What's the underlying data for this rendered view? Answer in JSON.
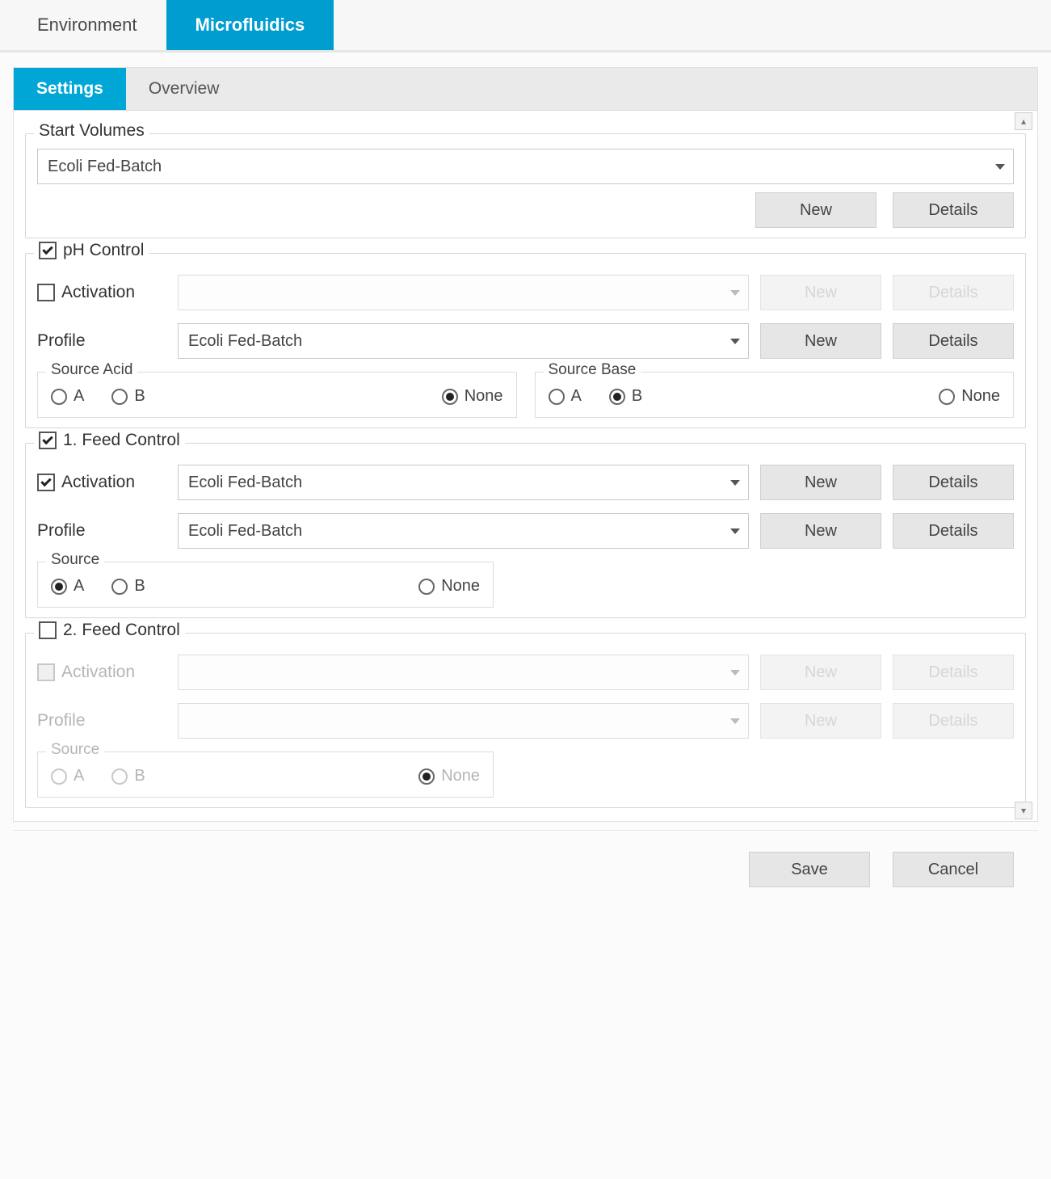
{
  "topTabs": {
    "environment": "Environment",
    "microfluidics": "Microfluidics",
    "active": "microfluidics"
  },
  "subTabs": {
    "settings": "Settings",
    "overview": "Overview",
    "active": "settings"
  },
  "startVolumes": {
    "legend": "Start Volumes",
    "selected": "Ecoli Fed-Batch",
    "newBtn": "New",
    "detailsBtn": "Details"
  },
  "phControl": {
    "legend": "pH Control",
    "checked": true,
    "activation": {
      "label": "Activation",
      "checked": false,
      "selected": "",
      "newBtn": "New",
      "detailsBtn": "Details"
    },
    "profile": {
      "label": "Profile",
      "selected": "Ecoli Fed-Batch",
      "newBtn": "New",
      "detailsBtn": "Details"
    },
    "sourceAcid": {
      "legend": "Source Acid",
      "options": {
        "a": "A",
        "b": "B",
        "none": "None"
      },
      "value": "none"
    },
    "sourceBase": {
      "legend": "Source Base",
      "options": {
        "a": "A",
        "b": "B",
        "none": "None"
      },
      "value": "b"
    }
  },
  "feed1": {
    "legend": "1. Feed Control",
    "checked": true,
    "activation": {
      "label": "Activation",
      "checked": true,
      "selected": "Ecoli Fed-Batch",
      "newBtn": "New",
      "detailsBtn": "Details"
    },
    "profile": {
      "label": "Profile",
      "selected": "Ecoli Fed-Batch",
      "newBtn": "New",
      "detailsBtn": "Details"
    },
    "source": {
      "legend": "Source",
      "options": {
        "a": "A",
        "b": "B",
        "none": "None"
      },
      "value": "a"
    }
  },
  "feed2": {
    "legend": "2. Feed Control",
    "checked": false,
    "activation": {
      "label": "Activation",
      "checked": false,
      "selected": "",
      "newBtn": "New",
      "detailsBtn": "Details"
    },
    "profile": {
      "label": "Profile",
      "selected": "",
      "newBtn": "New",
      "detailsBtn": "Details"
    },
    "source": {
      "legend": "Source",
      "options": {
        "a": "A",
        "b": "B",
        "none": "None"
      },
      "value": "none"
    }
  },
  "footer": {
    "save": "Save",
    "cancel": "Cancel"
  }
}
